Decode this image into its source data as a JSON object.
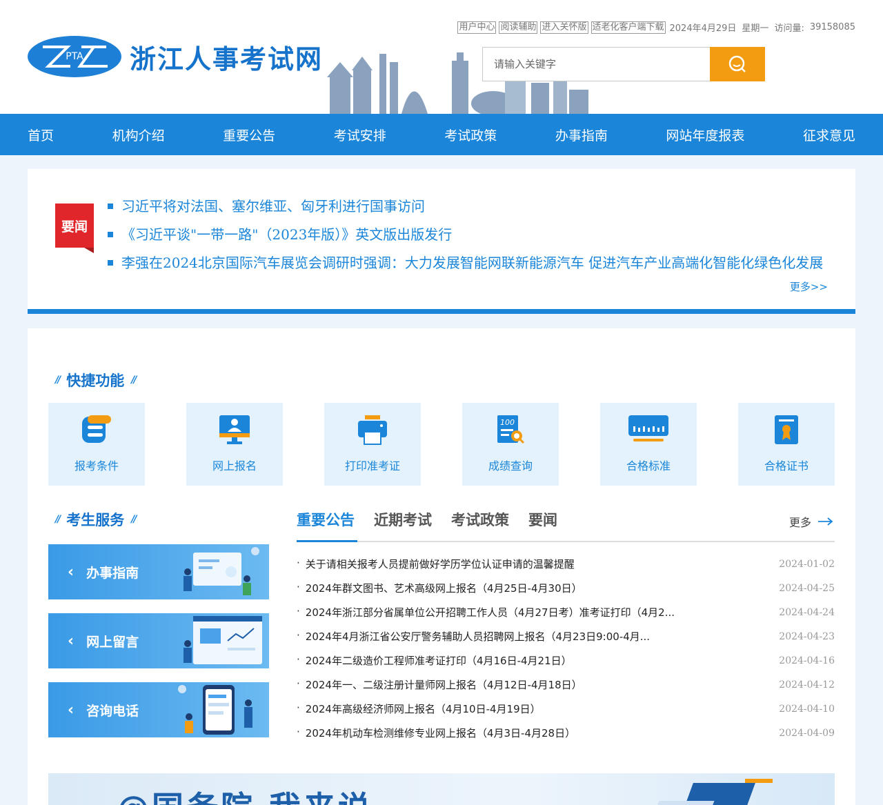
{
  "header": {
    "logo_mark": "PTA",
    "site_title": "浙江人事考试网",
    "top_links": [
      "用户中心",
      "阅读辅助",
      "进入关怀版",
      "适老化客户端下载"
    ],
    "date": "2024年4月29日",
    "weekday": "星期一",
    "visits_label": "访问量:",
    "visits_count": "39158085",
    "search_placeholder": "请输入关键字"
  },
  "nav": [
    "首页",
    "机构介绍",
    "重要公告",
    "考试安排",
    "考试政策",
    "办事指南",
    "网站年度报表",
    "征求意见"
  ],
  "news": {
    "tag": "要闻",
    "items": [
      "习近平将对法国、塞尔维亚、匈牙利进行国事访问",
      "《习近平谈\"一带一路\"（2023年版）》英文版出版发行",
      "李强在2024北京国际汽车展览会调研时强调：大力发展智能网联新能源汽车 促进汽车产业高端化智能化绿色化发展"
    ],
    "more": "更多>>"
  },
  "quick": {
    "title": "快捷功能",
    "items": [
      "报考条件",
      "网上报名",
      "打印准考证",
      "成绩查询",
      "合格标准",
      "合格证书"
    ]
  },
  "services": {
    "title": "考生服务",
    "items": [
      "办事指南",
      "网上留言",
      "咨询电话"
    ]
  },
  "tabs": {
    "items": [
      "重要公告",
      "近期考试",
      "考试政策",
      "要闻"
    ],
    "more": "更多"
  },
  "announcements": [
    {
      "title": "关于请相关报考人员提前做好学历学位认证申请的温馨提醒",
      "date": "2024-01-02"
    },
    {
      "title": "2024年群文图书、艺术高级网上报名（4月25日-4月30日）",
      "date": "2024-04-25"
    },
    {
      "title": "2024年浙江部分省属单位公开招聘工作人员（4月27日考）准考证打印（4月2...",
      "date": "2024-04-24"
    },
    {
      "title": "2024年4月浙江省公安厅警务辅助人员招聘网上报名（4月23日9:00-4月...",
      "date": "2024-04-23"
    },
    {
      "title": "2024年二级造价工程师准考证打印（4月16日-4月21日）",
      "date": "2024-04-16"
    },
    {
      "title": "2024年一、二级注册计量师网上报名（4月12日-4月18日）",
      "date": "2024-04-12"
    },
    {
      "title": "2024年高级经济师网上报名（4月10日-4月19日）",
      "date": "2024-04-10"
    },
    {
      "title": "2024年机动车检测维修专业网上报名（4月3日-4月28日）",
      "date": "2024-04-09"
    }
  ],
  "banner": {
    "text": "@国务院 我来说"
  }
}
